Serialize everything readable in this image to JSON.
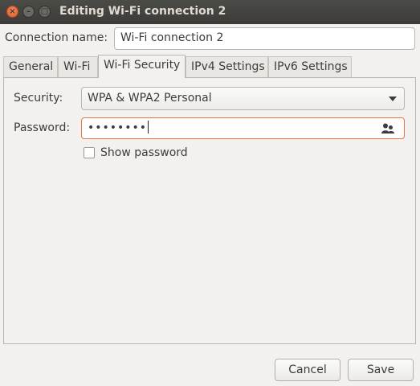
{
  "window": {
    "title": "Editing Wi-Fi connection 2"
  },
  "connection": {
    "label": "Connection name:",
    "value": "Wi-Fi connection 2"
  },
  "tabs": [
    {
      "label": "General"
    },
    {
      "label": "Wi-Fi"
    },
    {
      "label": "Wi-Fi Security",
      "active": true
    },
    {
      "label": "IPv4 Settings"
    },
    {
      "label": "IPv6 Settings"
    }
  ],
  "security": {
    "label": "Security:",
    "selected": "WPA & WPA2 Personal"
  },
  "password": {
    "label": "Password:",
    "masked": "••••••••"
  },
  "show_password": {
    "label": "Show password",
    "checked": false
  },
  "buttons": {
    "cancel": "Cancel",
    "save": "Save"
  },
  "colors": {
    "focus_border": "#e9743f",
    "titlebar": "#3c3b37",
    "close_button": "#e05a2b"
  }
}
